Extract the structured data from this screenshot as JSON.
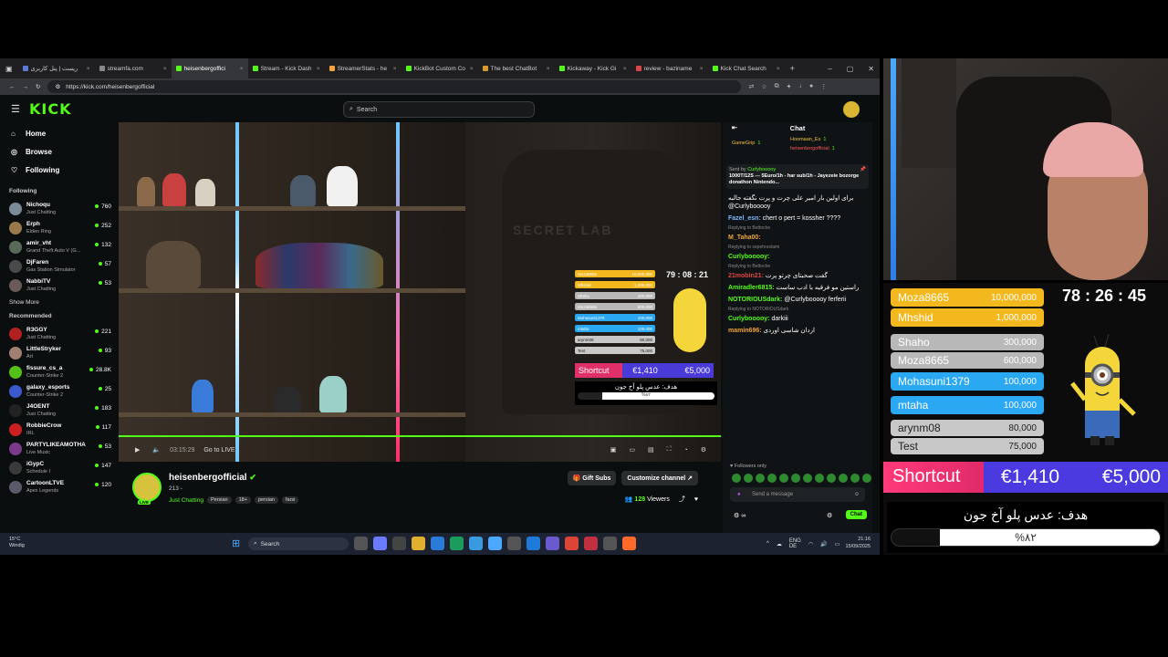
{
  "browser": {
    "tabs": [
      {
        "label": "ریست | پنل کاربری",
        "color": "#5b7bd6",
        "active": false
      },
      {
        "label": "streamfa.com",
        "color": "#888888",
        "active": false
      },
      {
        "label": "heisenbergoffici",
        "color": "#53fc18",
        "active": true
      },
      {
        "label": "Stream - Kick Dash",
        "color": "#53fc18",
        "active": false
      },
      {
        "label": "StreamerStats - he",
        "color": "#f2a33a",
        "active": false
      },
      {
        "label": "KickBot Custom Co",
        "color": "#53fc18",
        "active": false
      },
      {
        "label": "The best ChatBot",
        "color": "#d99a2b",
        "active": false
      },
      {
        "label": "Kickaway - Kick Gi",
        "color": "#53fc18",
        "active": false
      },
      {
        "label": "review - baziname",
        "color": "#e04444",
        "active": false
      },
      {
        "label": "Kick Chat Search",
        "color": "#53fc18",
        "active": false
      }
    ],
    "url": "https://kick.com/heisenbergofficial",
    "newtab": "+"
  },
  "kick": {
    "search_placeholder": "Search",
    "nav": [
      {
        "icon": "home-icon",
        "glyph": "⌂",
        "label": "Home"
      },
      {
        "icon": "compass-icon",
        "glyph": "◎",
        "label": "Browse"
      },
      {
        "icon": "heart-icon",
        "glyph": "♡",
        "label": "Following"
      }
    ],
    "following_title": "Following",
    "following": [
      {
        "name": "Nichoqu",
        "cat": "Just Chatting",
        "viewers": "760",
        "color": "#7a8a99"
      },
      {
        "name": "Erph",
        "cat": "Elden Ring",
        "viewers": "252",
        "color": "#9a7a4a"
      },
      {
        "name": "amir_vht",
        "cat": "Grand Theft Auto V (G...",
        "viewers": "132",
        "color": "#5a6a5a"
      },
      {
        "name": "DjFaren",
        "cat": "Gas Station Simulator",
        "viewers": "57",
        "color": "#4a4a4a"
      },
      {
        "name": "NabbiTV",
        "cat": "Just Chatting",
        "viewers": "53",
        "color": "#6a5a5a"
      }
    ],
    "show_more": "Show More",
    "recommended_title": "Recommended",
    "recommended": [
      {
        "name": "R3GGY",
        "cat": "Just Chatting",
        "viewers": "221",
        "color": "#b02020"
      },
      {
        "name": "LittleStryker",
        "cat": "Art",
        "viewers": "93",
        "color": "#a08070"
      },
      {
        "name": "fissure_cs_a",
        "cat": "Counter-Strike 2",
        "viewers": "28.8K",
        "color": "#53c018"
      },
      {
        "name": "galaxy_esports",
        "cat": "Counter-Strike 2",
        "viewers": "25",
        "color": "#3a5acc"
      },
      {
        "name": "J4OENT",
        "cat": "Just Chatting",
        "viewers": "183",
        "color": "#222222"
      },
      {
        "name": "RobbieCrow",
        "cat": "IRL",
        "viewers": "117",
        "color": "#cc2020"
      },
      {
        "name": "PARTYLIKEAMOTHA",
        "cat": "Live Music",
        "viewers": "53",
        "color": "#7a3a8a"
      },
      {
        "name": "iGypC",
        "cat": "Schedule I",
        "viewers": "147",
        "color": "#3a3a3a"
      },
      {
        "name": "CartoonLTVE",
        "cat": "Apex Legends",
        "viewers": "120",
        "color": "#5a5a6a"
      }
    ],
    "player": {
      "time": "03:15:29",
      "go_live": "Go to LIVE",
      "progress": 1.0,
      "watermark": "SECRET LAB"
    },
    "channel": {
      "name": "heisenbergofficial",
      "sub": "213 -",
      "category": "Just Chatting",
      "tags": [
        "Persian",
        "18+",
        "persian",
        "farsi"
      ],
      "gift_subs": "Gift Subs",
      "customize": "Customize channel",
      "viewers": "128",
      "viewers_label": "Viewers",
      "live_label": "LIVE"
    },
    "chat": {
      "title": "Chat",
      "top_gifters": [
        {
          "name": "GameGrip",
          "count": "1"
        },
        {
          "name": "Hoomaan_Es",
          "count": "1"
        },
        {
          "name": "heisenbergofficial",
          "count": "1"
        }
      ],
      "pinned_by": "Sent by",
      "pinned_user": "Curlybooooy",
      "pinned_text": "1000T/12S --- 5Euro/1h - har sub/1h - Jayezeie bozorge donathon Nintendo...",
      "messages": [
        {
          "user": "",
          "text": "برای اولین بار امیر علی چرت و پرت نگفته جالبه @Curlybooooy",
          "color": "#ffffff",
          "reply": ""
        },
        {
          "user": "Fazel_esn:",
          "text": "chert o pert = kossher ????",
          "color": "#7ab8ff",
          "reply": ""
        },
        {
          "user": "M_Taha00:",
          "text": "",
          "color": "#f2a33a",
          "reply": "Replying to Bettoche"
        },
        {
          "user": "Curlybooooy:",
          "text": "",
          "color": "#53fc18",
          "reply": "Replying to sepehreslami"
        },
        {
          "user": "21mobin21:",
          "text": "گفت صحبتای چرتو پرت",
          "color": "#e04444",
          "reply": "Replying to Bettoche"
        },
        {
          "user": "Amiradler6815:",
          "text": "راستین مو فرقیه با ادب ساست",
          "color": "#53fc18",
          "reply": ""
        },
        {
          "user": "NOTORIOUSdark:",
          "text": "@Curlybooooy ferferii",
          "color": "#53fc18",
          "reply": ""
        },
        {
          "user": "Curlybooooy:",
          "text": "darkiii",
          "color": "#53fc18",
          "reply": "Replying to NOTORIOUSdark"
        },
        {
          "user": "mamin696:",
          "text": "اردان شاسی اوردی",
          "color": "#f2a33a",
          "reply": ""
        }
      ],
      "followers_only": "Followers only",
      "placeholder": "Send a message",
      "send_label": "Chat",
      "points": "∞"
    }
  },
  "taskbar": {
    "weather_temp": "15°C",
    "weather_desc": "Windig",
    "search_placeholder": "Search",
    "lang": "ENG",
    "lang_sub": "DE",
    "time": "21:16",
    "date": "15/09/2025",
    "app_colors": [
      "#555",
      "#6a7bff",
      "#444",
      "#e0b030",
      "#2a7bd8",
      "#1c9c5c",
      "#3a9ae0",
      "#4aa8ff",
      "#555",
      "#1e7ad8",
      "#6a5acd",
      "#db4437",
      "#c03040",
      "#555",
      "#ff6a2a"
    ]
  },
  "overlay": {
    "timer": "78 : 26 : 45",
    "mini_timer": "79 : 08 : 21",
    "leaderboard": [
      {
        "name": "Moza8665",
        "value": "10,000,000",
        "color": "#f2b81e",
        "text_color": "#ffffff"
      },
      {
        "name": "Mhshid",
        "value": "1,000,000",
        "color": "#f2b81e",
        "text_color": "#ffffff"
      },
      {
        "name": "Shaho",
        "value": "300,000",
        "color": "#b8b8b8",
        "text_color": "#ffffff"
      },
      {
        "name": "Moza8665",
        "value": "600,000",
        "color": "#b8b8b8",
        "text_color": "#ffffff"
      },
      {
        "name": "Mohasuni1379",
        "value": "100,000",
        "color": "#2aa8f2",
        "text_color": "#ffffff"
      },
      {
        "name": "mtaha",
        "value": "100,000",
        "color": "#2aa8f2",
        "text_color": "#ffffff"
      },
      {
        "name": "arynm08",
        "value": "80,000",
        "color": "#c8c8c8",
        "text_color": "#222222"
      },
      {
        "name": "Test",
        "value": "75,000",
        "color": "#c8c8c8",
        "text_color": "#222222"
      }
    ],
    "shortcut": {
      "label": "Shortcut",
      "current": "€1,410",
      "goal": "€5,000"
    },
    "goal": {
      "title": "هدف: عدس پلو آخ جون",
      "percent_label": "%۸۲",
      "fraction": 0.82
    }
  }
}
